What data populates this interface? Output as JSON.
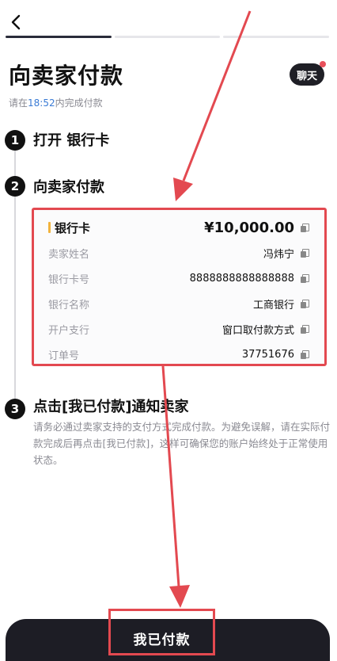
{
  "header": {
    "back_icon": "chevron-left-icon"
  },
  "page": {
    "title": "向卖家付款",
    "chat_label": "聊天",
    "deadline_prefix": "请在",
    "deadline_time": "18:52",
    "deadline_suffix": "内完成付款"
  },
  "steps": [
    {
      "num": "1",
      "label": "打开 银行卡"
    },
    {
      "num": "2",
      "label": "向卖家付款"
    },
    {
      "num": "3",
      "label": "点击[我已付款]通知卖家"
    }
  ],
  "payment": {
    "method": "银行卡",
    "amount": "¥10,000.00",
    "rows": [
      {
        "label": "卖家姓名",
        "value": "冯炜宁"
      },
      {
        "label": "银行卡号",
        "value": "8888888888888888"
      },
      {
        "label": "银行名称",
        "value": "工商银行"
      },
      {
        "label": "开户支行",
        "value": "窗口取付款方式"
      },
      {
        "label": "订单号",
        "value": "37751676"
      }
    ]
  },
  "notice": "请务必通过卖家支持的支付方式完成付款。为避免误解，请在实际付款完成后再点击[我已付款]，这样可确保您的账户始终处于正常使用状态。",
  "action": {
    "paid_label": "我已付款"
  },
  "colors": {
    "accent_red": "#e34950",
    "dark": "#1d1d25",
    "time_blue": "#3a7bd5"
  }
}
